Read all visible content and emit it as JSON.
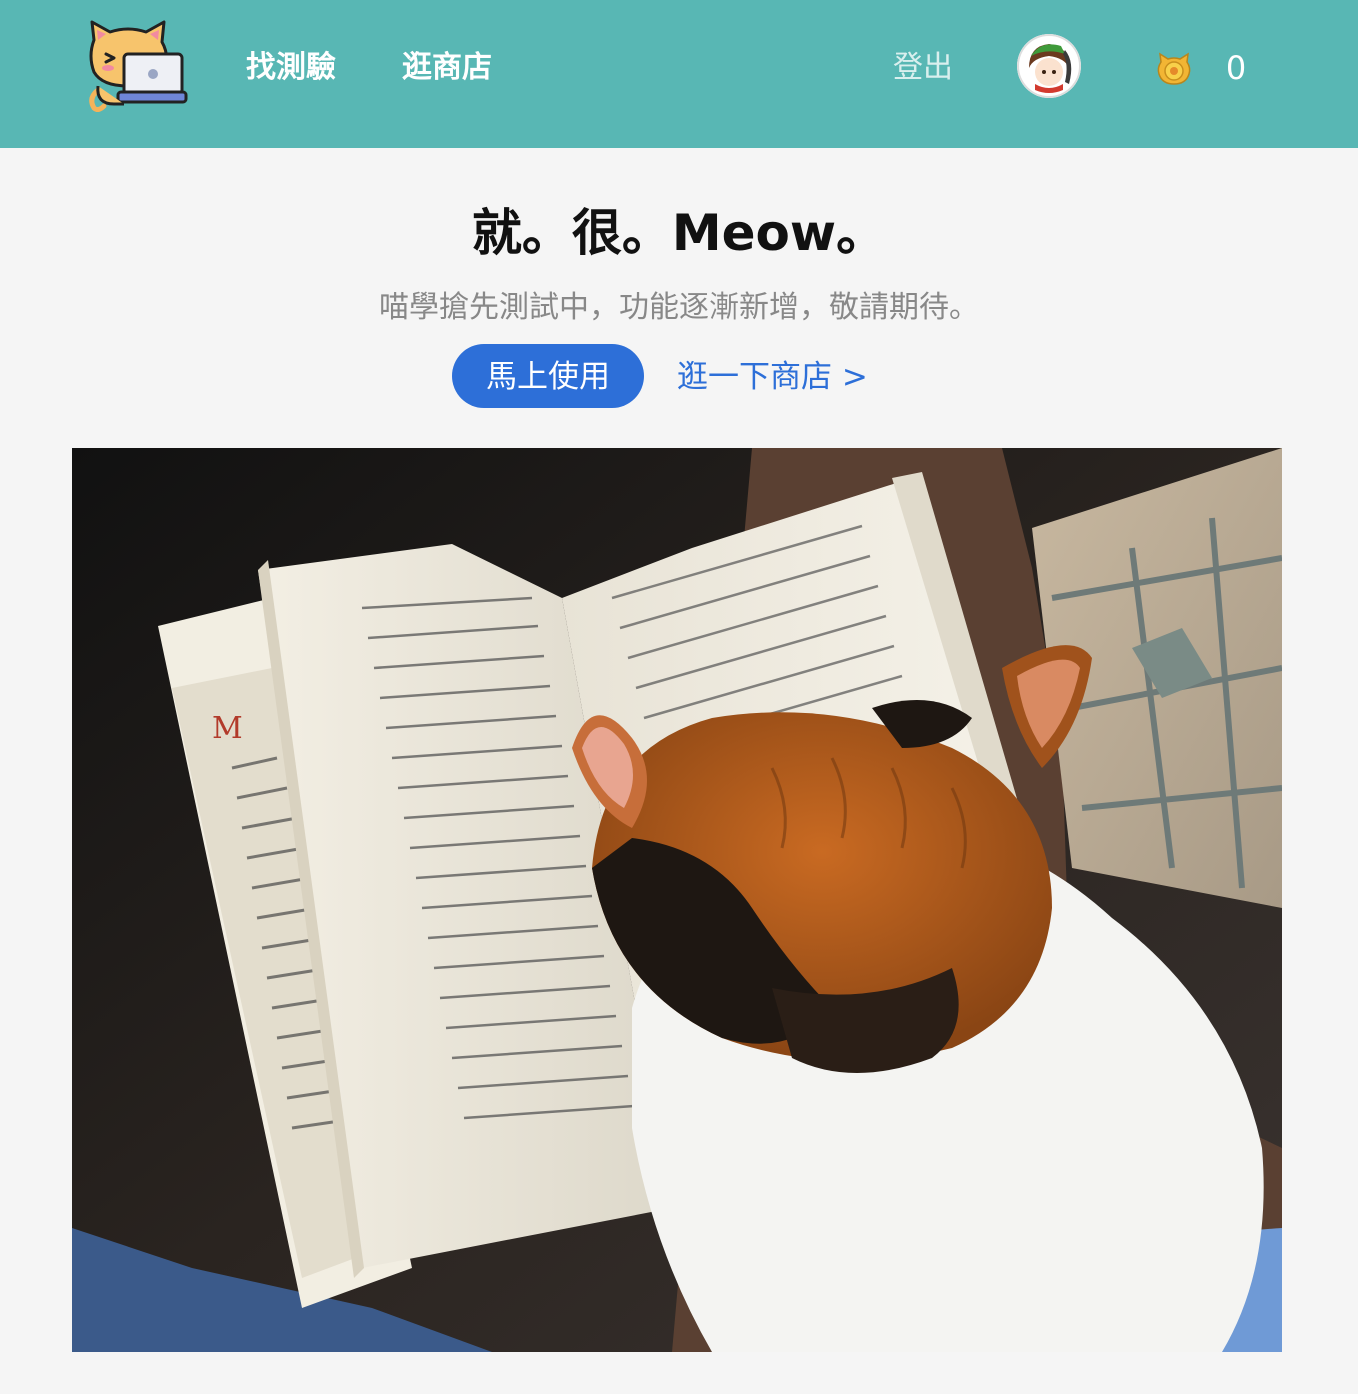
{
  "navbar": {
    "background": "#58b7b4",
    "logo": "cat-laptop-logo",
    "links": [
      {
        "label": "找測驗"
      },
      {
        "label": "逛商店"
      }
    ],
    "logout_label": "登出",
    "avatar": "user-avatar",
    "coin_icon": "cat-coin-icon",
    "coin_count": "0"
  },
  "hero": {
    "title": "就。很。Meow。",
    "subtitle": "喵學搶先測試中，功能逐漸新增，敬請期待。",
    "primary_button_label": "馬上使用",
    "primary_button_color": "#2d6fd8",
    "secondary_link_label": "逛一下商店 >",
    "image": "calico-cat-reading-book-photo"
  }
}
